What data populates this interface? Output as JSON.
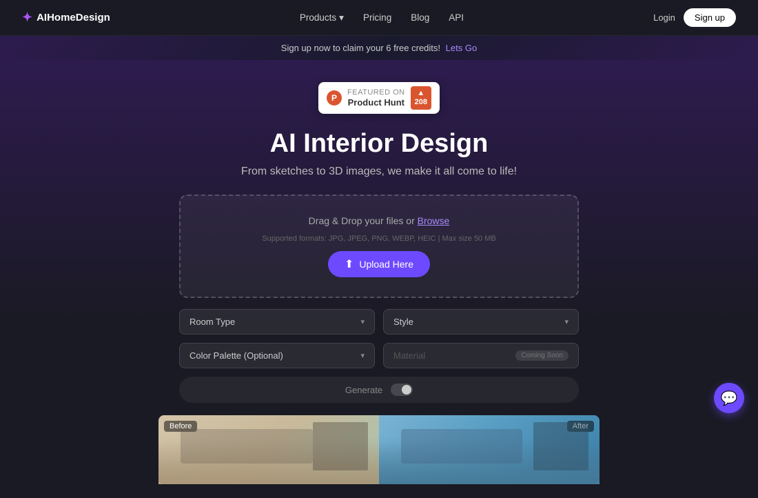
{
  "nav": {
    "logo_star": "✦",
    "logo_text": "AIHomeDesign",
    "links": [
      {
        "label": "Products",
        "has_dropdown": true
      },
      {
        "label": "Pricing",
        "has_dropdown": false
      },
      {
        "label": "Blog",
        "has_dropdown": false
      },
      {
        "label": "API",
        "has_dropdown": false
      }
    ],
    "login_label": "Login",
    "signup_label": "Sign up"
  },
  "announcement": {
    "text": "Sign up now to claim your 6 free credits!",
    "link_text": "Lets Go"
  },
  "producthunt": {
    "featured_text": "FEATURED ON",
    "product_name": "Product Hunt",
    "arrow": "▲",
    "score": "208"
  },
  "hero": {
    "title": "AI Interior Design",
    "subtitle": "From sketches to 3D images, we make it all come to life!"
  },
  "upload": {
    "drag_text": "Drag & Drop your files or",
    "browse_link": "Browse",
    "formats_text": "Supported formats: JPG, JPEG, PNG, WEBP, HEIC  |  Max size 50 MB",
    "upload_button_label": "Upload Here",
    "upload_icon": "⬆"
  },
  "options": {
    "room_type_label": "Room Type",
    "style_label": "Style",
    "color_palette_label": "Color Palette (Optional)",
    "material_label": "Material",
    "coming_soon_label": "Coming Soon"
  },
  "generate": {
    "label": "Generate"
  },
  "panels": {
    "before_label": "Before",
    "after_label": "After"
  },
  "chat": {
    "icon": "💬"
  }
}
